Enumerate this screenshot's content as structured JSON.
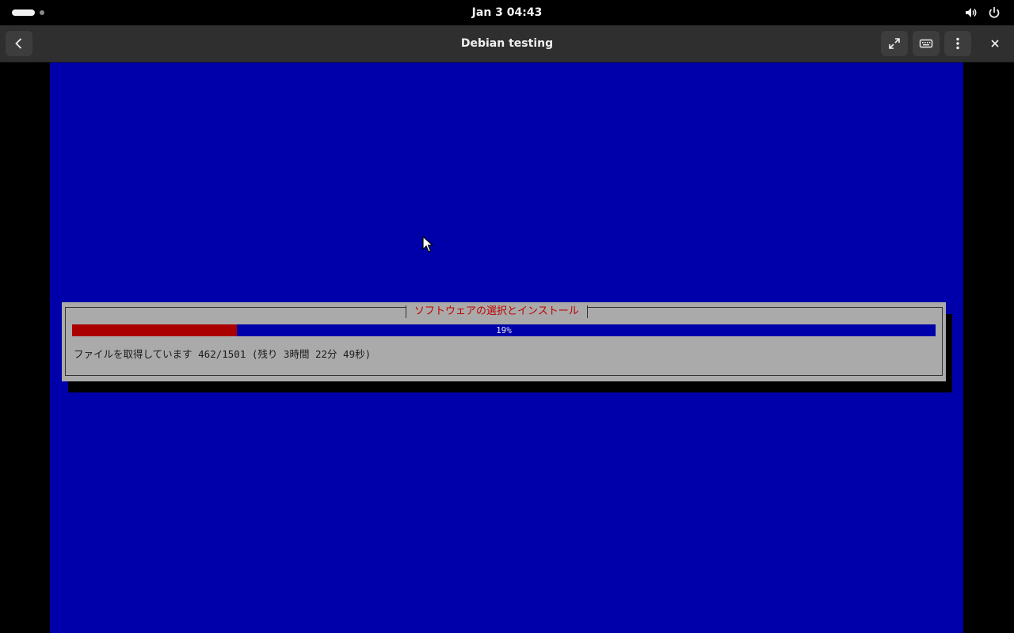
{
  "topbar": {
    "clock": "Jan 3  04:43",
    "tray": {
      "volume_icon": "volume-icon",
      "power_icon": "power-icon"
    }
  },
  "headerbar": {
    "title": "Debian testing",
    "back_icon": "back-arrow-icon",
    "fullscreen_icon": "fullscreen-icon",
    "keyboard_icon": "keyboard-icon",
    "menu_icon": "kebab-menu-icon",
    "close_icon": "close-icon"
  },
  "installer": {
    "background_color": "#0000aa",
    "dialog_title": "ソフトウェアの選択とインストール",
    "progress": {
      "percent": 19,
      "label": "19%",
      "fill_color": "#aa0000",
      "track_color": "#0000aa"
    },
    "status": "ファイルを取得しています 462/1501 (残り 3時間 22分 49秒)"
  }
}
